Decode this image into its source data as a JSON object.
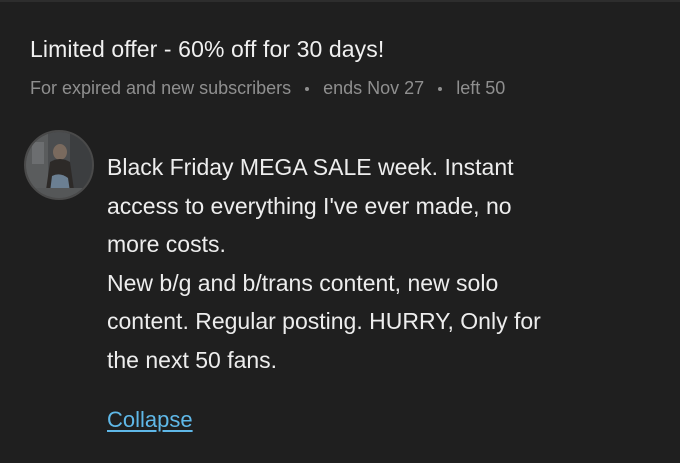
{
  "offer": {
    "title": "Limited offer - 60% off for 30 days!",
    "audience": "For expired and new subscribers",
    "ends": "ends Nov 27",
    "left": "left 50"
  },
  "message": {
    "lines": [
      "Black Friday MEGA SALE week. Instant",
      "access to everything I've ever made, no",
      "more costs.",
      "New b/g and b/trans content, new solo",
      "content. Regular posting. HURRY, Only for",
      "the next 50 fans."
    ],
    "collapse_label": "Collapse"
  },
  "icons": {
    "avatar": "user-avatar-photo",
    "separator": "bullet-dot-icon"
  },
  "colors": {
    "background": "#1f1f1f",
    "title": "#f0f0f0",
    "meta": "#8f8f8f",
    "body_text": "#ededed",
    "link": "#5fb8e8"
  }
}
